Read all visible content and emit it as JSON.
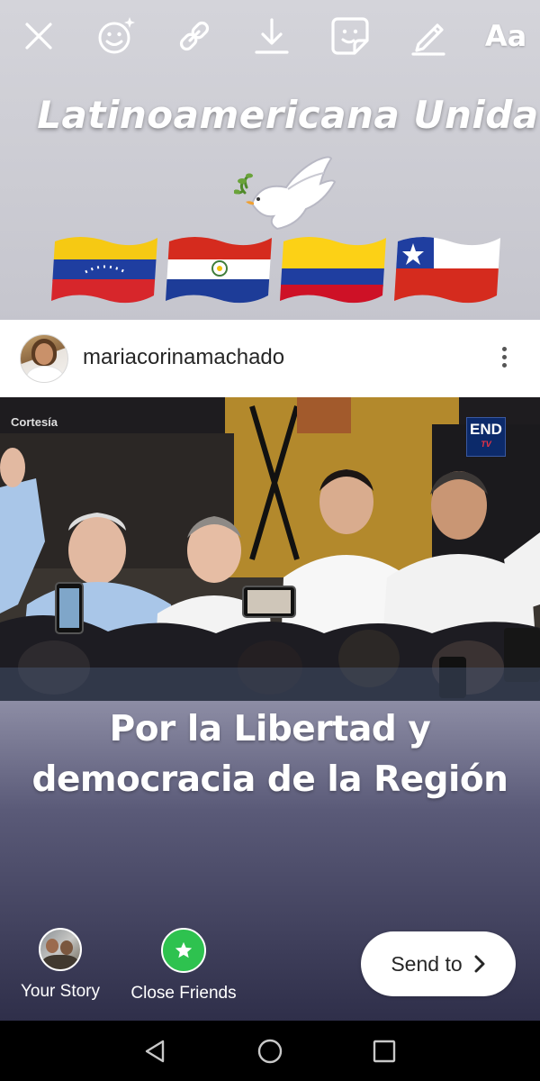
{
  "toolbar": {
    "items": [
      {
        "name": "close-icon"
      },
      {
        "name": "face-sparkle-effects-icon"
      },
      {
        "name": "link-icon"
      },
      {
        "name": "download-icon"
      },
      {
        "name": "sticker-icon"
      },
      {
        "name": "pen-draw-icon"
      },
      {
        "name": "text-tool",
        "label": "Aa"
      }
    ]
  },
  "story": {
    "headline": "Latinoamericana Unida",
    "emojis": [
      "dove",
      "flag-venezuela",
      "flag-paraguay",
      "flag-colombia",
      "flag-chile"
    ]
  },
  "post": {
    "username": "mariacorinamachado",
    "photo_watermark_left": "Cortesía",
    "photo_watermark_right": "END",
    "photo_watermark_right_sub": "TV",
    "caption_line1": "Por la Libertad y",
    "caption_line2": "democracia de la Región"
  },
  "share": {
    "your_story_label": "Your Story",
    "close_friends_label": "Close Friends",
    "send_label": "Send to"
  },
  "colors": {
    "close_friends_green": "#2ec24f",
    "text_white": "#ffffff"
  },
  "android_nav": [
    "back-icon",
    "home-icon",
    "recents-icon"
  ]
}
